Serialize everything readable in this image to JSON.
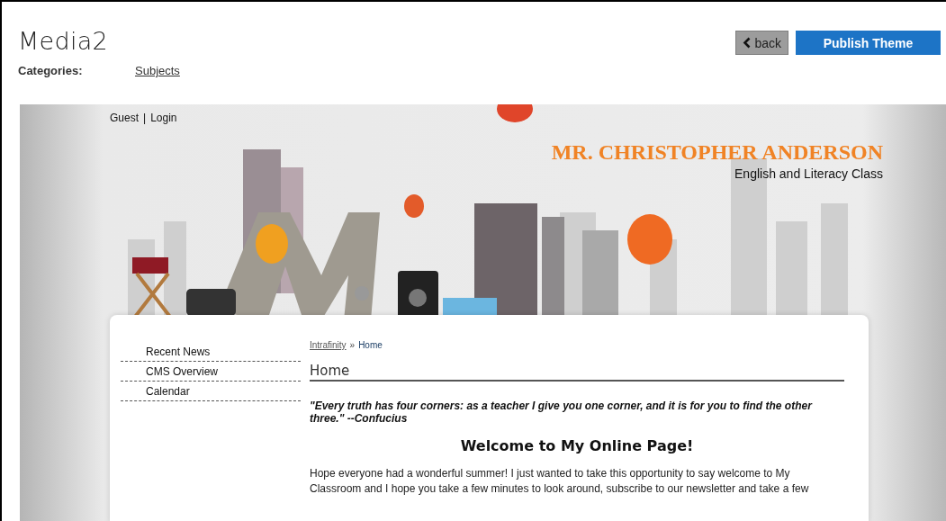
{
  "header": {
    "title": "Media2",
    "back_label": "back",
    "publish_label": "Publish Theme",
    "categories_label": "Categories:",
    "categories": [
      "Subjects"
    ]
  },
  "preview": {
    "account_links": [
      {
        "label": "Guest"
      },
      {
        "label": "Login"
      }
    ],
    "separator": "|",
    "site_title": "MR. CHRISTOPHER ANDERSON",
    "site_subtitle": "English and Literacy Class",
    "menu": [
      {
        "label": "Recent News"
      },
      {
        "label": "CMS Overview"
      },
      {
        "label": "Calendar"
      }
    ],
    "breadcrumb": [
      {
        "label": "Intrafinity",
        "link": true
      },
      {
        "label": "Home",
        "link": false
      }
    ],
    "breadcrumb_separator": "»",
    "page_heading": "Home",
    "quote": "\"Every truth has four corners: as a teacher I give you one corner, and it is for you to find the other three.\" --Confucius",
    "welcome_heading": "Welcome to My Online Page!",
    "intro": "Hope everyone had a wonderful summer! I just wanted to take this opportunity to say welcome to My Classroom and I hope you take a few minutes to look around, subscribe to our newsletter and take a few"
  }
}
